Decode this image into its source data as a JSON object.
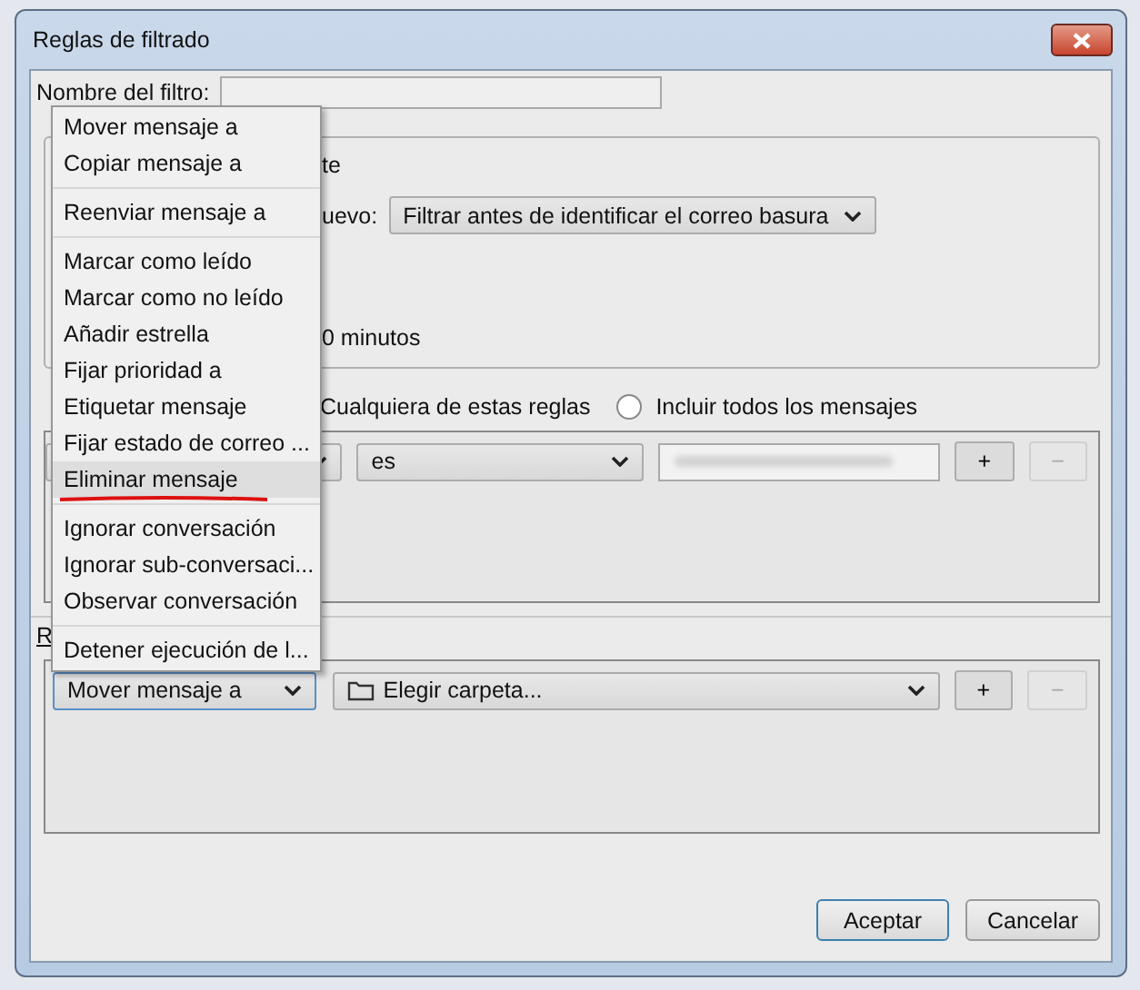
{
  "window": {
    "title": "Reglas de filtrado"
  },
  "filter_name": {
    "label": "Nombre del filtro:"
  },
  "apply_group": {
    "texts": [
      "te"
    ],
    "new_mail_label": "uevo:",
    "new_mail_dropdown": "Filtrar antes de identificar el correo basura",
    "periodic_text": "0 minutos"
  },
  "match": {
    "cut_label": "Cualquiera de estas reglas",
    "radio": {
      "label": "Incluir todos los mensajes",
      "selected": false
    }
  },
  "conditions": [
    {
      "operator": "es",
      "add": "+",
      "remove": "−",
      "remove_disabled": true
    }
  ],
  "actions_label": "R",
  "actions": [
    {
      "action": "Mover mensaje a",
      "target": "Elegir carpeta...",
      "add": "+",
      "remove": "−",
      "remove_disabled": true
    }
  ],
  "buttons": [
    {
      "label": "Aceptar",
      "default": true
    },
    {
      "label": "Cancelar",
      "default": false
    }
  ],
  "action_menu": {
    "groups": [
      [
        {
          "label": "Mover mensaje a",
          "selected": false,
          "marked": false
        },
        {
          "label": "Copiar mensaje a",
          "selected": false,
          "marked": false
        }
      ],
      [
        {
          "label": "Reenviar mensaje a",
          "selected": false,
          "marked": false
        }
      ],
      [
        {
          "label": "Marcar como leído",
          "selected": false,
          "marked": false
        },
        {
          "label": "Marcar como no leído",
          "selected": false,
          "marked": false
        },
        {
          "label": "Añadir estrella",
          "selected": false,
          "marked": false
        },
        {
          "label": "Fijar prioridad a",
          "selected": false,
          "marked": false
        },
        {
          "label": "Etiquetar mensaje",
          "selected": false,
          "marked": false
        },
        {
          "label": "Fijar estado de correo ...",
          "selected": false,
          "marked": false
        },
        {
          "label": "Eliminar mensaje",
          "selected": true,
          "marked": true
        }
      ],
      [
        {
          "label": "Ignorar conversación",
          "selected": false,
          "marked": false
        },
        {
          "label": "Ignorar sub-conversaci...",
          "selected": false,
          "marked": false
        },
        {
          "label": "Observar conversación",
          "selected": false,
          "marked": false
        }
      ],
      [
        {
          "label": "Detener ejecución de l...",
          "selected": false,
          "marked": false
        }
      ]
    ]
  }
}
